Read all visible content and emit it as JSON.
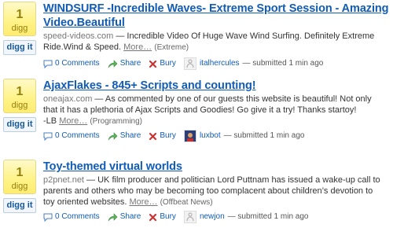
{
  "stories": [
    {
      "count": "1",
      "digg_label": "digg",
      "digg_it": "digg it",
      "title_line1": "WINDSURF -Incredible Waves- Extreme Sport Session - Amazing",
      "title_line2": "Video.Beautiful",
      "source": "speed-videos.com",
      "desc_part1": " — Incredible Video Of Huge Wave Wind Surfing. Definitely Extreme",
      "desc_part2": "Ride.Wind & Speed.",
      "more": "More…",
      "topic": "(Extreme)",
      "comments": "0 Comments",
      "share": "Share",
      "bury": "Bury",
      "user": "italhercules",
      "submitted": "— submitted 1 min ago",
      "avatar_color": "#e8e8e8"
    },
    {
      "count": "1",
      "digg_label": "digg",
      "digg_it": "digg it",
      "title_line1": "AjaxFlakes - 845+ Scripts and counting!",
      "title_line2": "",
      "source": "oneajax.com",
      "desc_part1": " — As commented by one of our guests this website is beautiful! Not only",
      "desc_part2": "that it has a plethoria of Ajax Scripts and Goodies! Go give it a try! Thanks startoy!",
      "desc_part3": "-LB",
      "more": "More…",
      "topic": "(Programming)",
      "comments": "0 Comments",
      "share": "Share",
      "bury": "Bury",
      "user": "luxbot",
      "submitted": "— submitted 1 min ago",
      "avatar_color": "#2a3f7a"
    },
    {
      "count": "1",
      "digg_label": "digg",
      "digg_it": "digg it",
      "title_line1": "Toy-themed virtual worlds",
      "title_line2": "",
      "source": "p2pnet.net",
      "desc_part1": " — UK film producer and politician Lord Puttnam has issued a wake-up call to",
      "desc_part2": "parents and others who may be becoming too complacent about children’s devotion to",
      "desc_part3": "toy oriented websites.",
      "more": "More…",
      "topic": "(Offbeat News)",
      "comments": "0 Comments",
      "share": "Share",
      "bury": "Bury",
      "user": "newjon",
      "submitted": "— submitted 1 min ago",
      "avatar_color": "#e8e8e8"
    }
  ],
  "colors": {
    "link": "#105cb6",
    "digg_badge": "#fff38a",
    "bury": "#cc3333",
    "share": "#3a9a3a"
  }
}
